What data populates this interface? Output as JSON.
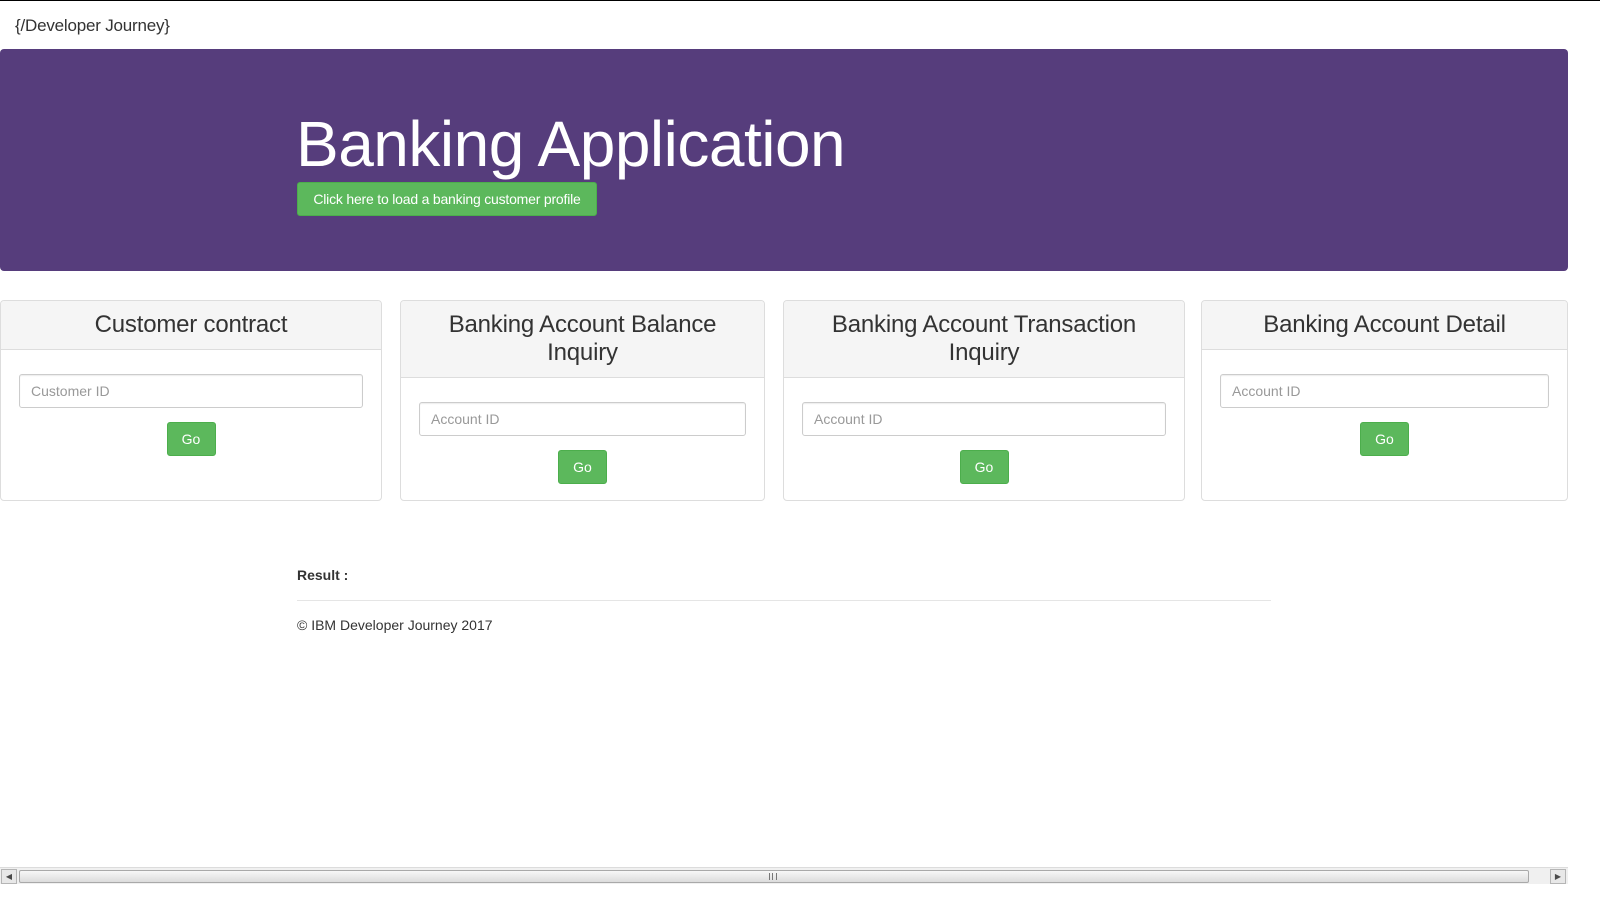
{
  "navbar": {
    "brand": "{/Developer Journey}"
  },
  "hero": {
    "title": "Banking Application",
    "button_label": "Click here to load a banking customer profile",
    "background_color": "#563d7c",
    "button_color": "#5cb85c"
  },
  "panels": [
    {
      "heading": "Customer contract",
      "input_placeholder": "Customer ID",
      "input_value": "",
      "button_label": "Go"
    },
    {
      "heading": "Banking Account Balance Inquiry",
      "input_placeholder": "Account ID",
      "input_value": "",
      "button_label": "Go"
    },
    {
      "heading": "Banking Account Transaction Inquiry",
      "input_placeholder": "Account ID",
      "input_value": "",
      "button_label": "Go"
    },
    {
      "heading": "Banking Account Detail",
      "input_placeholder": "Account ID",
      "input_value": "",
      "button_label": "Go"
    }
  ],
  "result": {
    "label": "Result :"
  },
  "footer": {
    "text": "© IBM Developer Journey 2017"
  },
  "scrollbar": {
    "left_arrow_icon": "chevron-left-icon",
    "right_arrow_icon": "chevron-right-icon",
    "left_glyph": "◀",
    "right_glyph": "▶"
  }
}
